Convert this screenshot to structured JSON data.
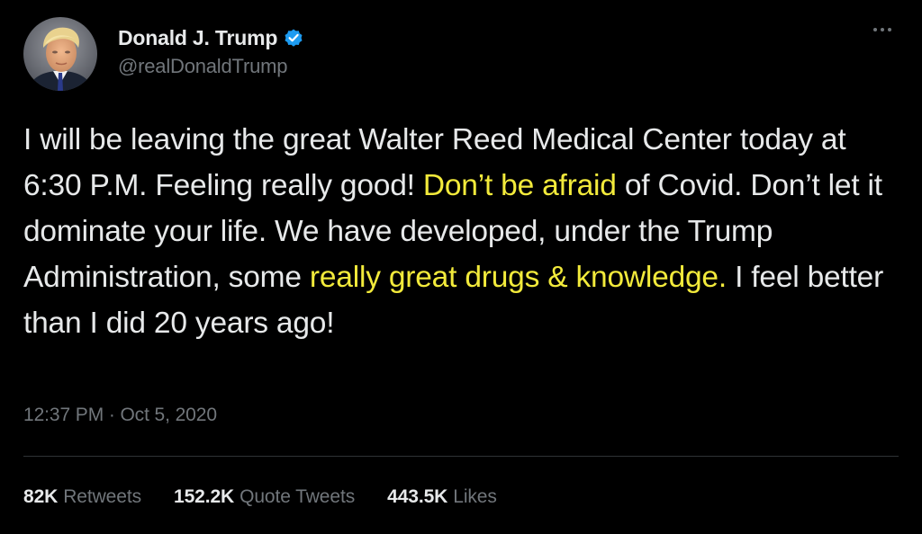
{
  "author": {
    "display_name": "Donald J. Trump",
    "handle": "@realDonaldTrump",
    "verified": true
  },
  "tweet": {
    "segments": [
      {
        "text": "I will be leaving the great Walter Reed Medical Center today at 6:30 P.M. Feeling really good! ",
        "highlight": false
      },
      {
        "text": "Don’t be afraid",
        "highlight": true
      },
      {
        "text": " of Covid. Don’t let it dominate your life. We have developed, under the Trump Administration, some ",
        "highlight": false
      },
      {
        "text": "really great drugs & knowledge.",
        "highlight": true
      },
      {
        "text": " I feel better than I did 20 years ago!",
        "highlight": false
      }
    ],
    "timestamp": "12:37 PM · Oct 5, 2020"
  },
  "stats": {
    "retweets_count": "82K",
    "retweets_label": "Retweets",
    "quotes_count": "152.2K",
    "quotes_label": "Quote Tweets",
    "likes_count": "443.5K",
    "likes_label": "Likes"
  },
  "colors": {
    "background": "#000000",
    "primary_text": "#e7e9ea",
    "secondary_text": "#71767b",
    "highlight": "#f2ea3b",
    "verified_badge": "#1d9bf0",
    "divider": "#2f3336"
  },
  "icons": {
    "verified": "verified-badge-icon",
    "more": "more-options-icon"
  }
}
